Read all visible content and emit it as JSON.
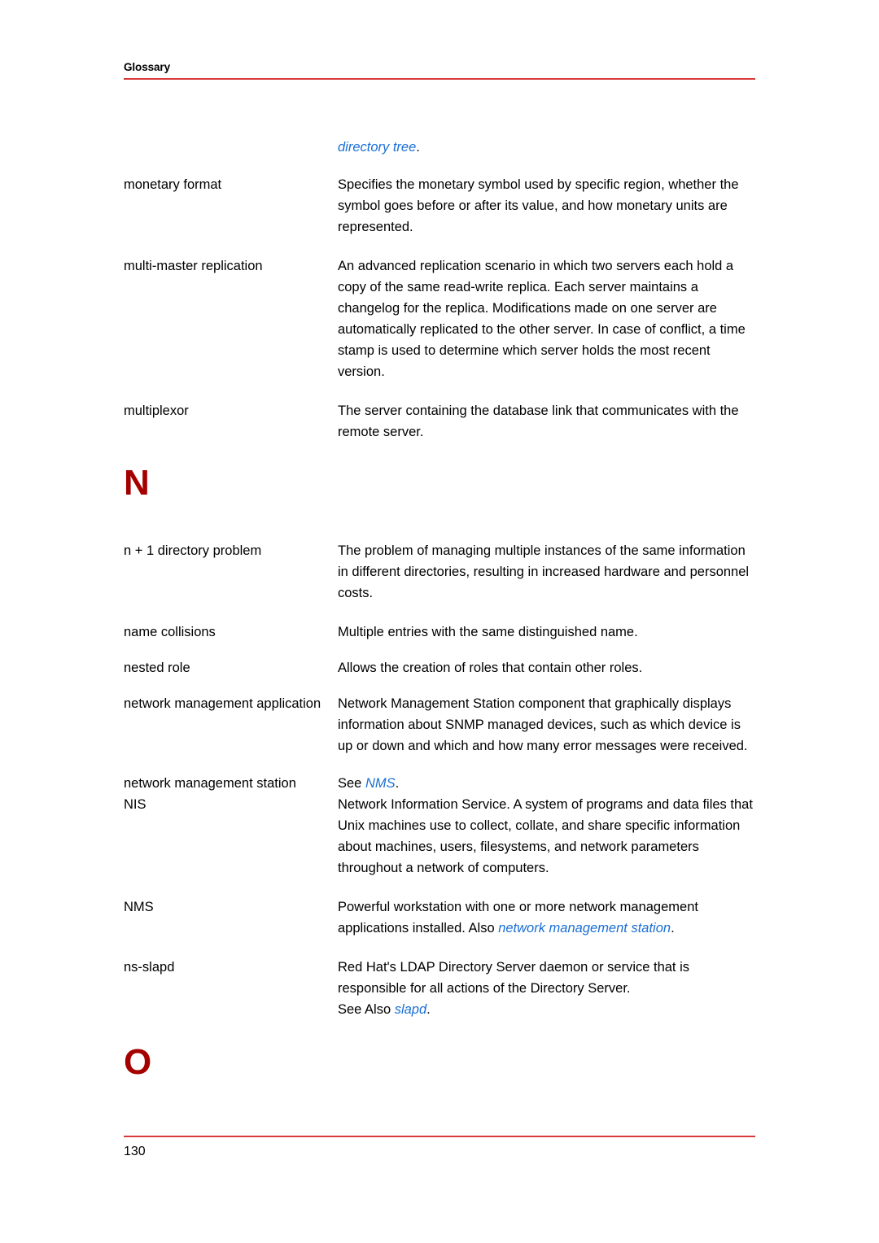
{
  "header": {
    "title": "Glossary"
  },
  "footer": {
    "page_number": "130"
  },
  "colors": {
    "rule_red": "#d83a3a",
    "section_letter_red": "#a50000",
    "xref_blue": "#1a6fd4",
    "text_black": "#000000",
    "page_background": "#ffffff"
  },
  "continuation": {
    "xref": "directory tree",
    "trailing": "."
  },
  "entries": [
    {
      "term": "monetary format",
      "definition": "Specifies the monetary symbol used by specific region, whether the symbol goes before or after its value, and how monetary units are represented."
    },
    {
      "term": "multi-master replication",
      "definition": "An advanced replication scenario in which two servers each hold a copy of the same read-write replica. Each server maintains a changelog for the replica. Modifications made on one server are automatically replicated to the other server. In case of conflict, a time stamp is used to determine which server holds the most recent version."
    },
    {
      "term": "multiplexor",
      "definition": "The server containing the database link that communicates with the remote server."
    }
  ],
  "section_n": {
    "letter": "N",
    "entries": [
      {
        "term": "n + 1 directory problem",
        "definition": "The problem of managing multiple instances of the same information in different directories, resulting in increased hardware and personnel costs."
      },
      {
        "term": "name collisions",
        "definition": "Multiple entries with the same distinguished name."
      },
      {
        "term": "nested role",
        "definition": "Allows the creation of roles that contain other roles."
      },
      {
        "term": "network management application",
        "definition": "Network Management Station component that graphically displays information about SNMP managed devices, such as which device is up or down and which and how many error messages were received."
      },
      {
        "term": "network management station",
        "def_prefix": "See ",
        "def_xref": "NMS",
        "def_suffix": "."
      },
      {
        "term": "NIS",
        "definition": "Network Information Service. A system of programs and data files that Unix machines use to collect, collate, and share specific information about machines, users, filesystems, and network parameters throughout a network of computers."
      },
      {
        "term": "NMS",
        "def_prefix": "Powerful workstation with one or more network management applications installed. Also ",
        "def_xref": "network management station",
        "def_suffix": "."
      },
      {
        "term": "ns-slapd",
        "def_prefix": "Red Hat's LDAP Directory Server daemon or service that is responsible for all actions of the Directory Server.",
        "def_see_also_label": "See Also ",
        "def_xref": "slapd",
        "def_suffix": "."
      }
    ]
  },
  "section_o": {
    "letter": "O"
  }
}
